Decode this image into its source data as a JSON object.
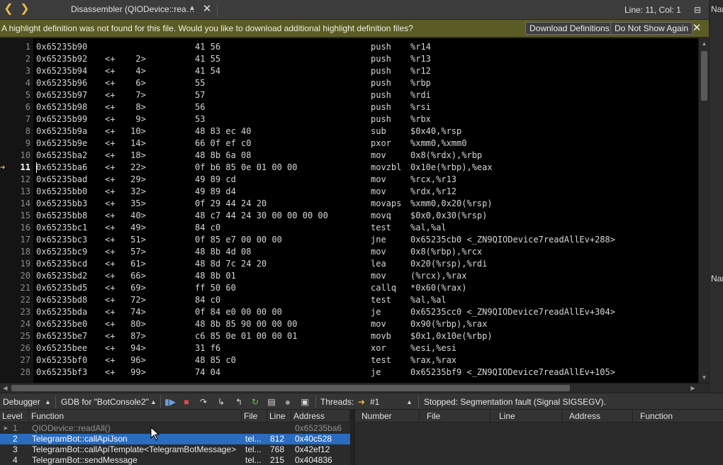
{
  "topbar": {
    "back_icon": "chevron-left-icon",
    "forward_icon": "chevron-right-icon",
    "document_title": "Disassembler (QIODevice::rea…",
    "chooser_icon": "updown-chevron-icon",
    "close_icon": "close-icon",
    "line_col": "Line: 11, Col: 1",
    "split_icon": "split-editor-icon",
    "accent_color": "#e8b84a"
  },
  "right_strip": {
    "label_top": "Nar",
    "label_bottom": "Nar"
  },
  "infobar": {
    "message": "A highlight definition was not found for this file. Would you like to download additional highlight definition files?",
    "download_button": "Download Definitions",
    "dont_show_button": "Do Not Show Again",
    "close_icon": "close-icon",
    "background_color": "#5b5b26"
  },
  "editor": {
    "current_line": 11,
    "lines": [
      {
        "n": "1",
        "addr": "0x65235b90",
        "rel": "",
        "bytes": "41 56",
        "mnem": "push",
        "ops": "%r14"
      },
      {
        "n": "2",
        "addr": "0x65235b92",
        "rel": "<+    2>",
        "bytes": "41 55",
        "mnem": "push",
        "ops": "%r13"
      },
      {
        "n": "3",
        "addr": "0x65235b94",
        "rel": "<+    4>",
        "bytes": "41 54",
        "mnem": "push",
        "ops": "%r12"
      },
      {
        "n": "4",
        "addr": "0x65235b96",
        "rel": "<+    6>",
        "bytes": "55",
        "mnem": "push",
        "ops": "%rbp"
      },
      {
        "n": "5",
        "addr": "0x65235b97",
        "rel": "<+    7>",
        "bytes": "57",
        "mnem": "push",
        "ops": "%rdi"
      },
      {
        "n": "6",
        "addr": "0x65235b98",
        "rel": "<+    8>",
        "bytes": "56",
        "mnem": "push",
        "ops": "%rsi"
      },
      {
        "n": "7",
        "addr": "0x65235b99",
        "rel": "<+    9>",
        "bytes": "53",
        "mnem": "push",
        "ops": "%rbx"
      },
      {
        "n": "8",
        "addr": "0x65235b9a",
        "rel": "<+   10>",
        "bytes": "48 83 ec 40",
        "mnem": "sub",
        "ops": "$0x40,%rsp"
      },
      {
        "n": "9",
        "addr": "0x65235b9e",
        "rel": "<+   14>",
        "bytes": "66 0f ef c0",
        "mnem": "pxor",
        "ops": "%xmm0,%xmm0"
      },
      {
        "n": "10",
        "addr": "0x65235ba2",
        "rel": "<+   18>",
        "bytes": "48 8b 6a 08",
        "mnem": "mov",
        "ops": "0x8(%rdx),%rbp"
      },
      {
        "n": "11",
        "addr": "0x65235ba6",
        "rel": "<+   22>",
        "bytes": "0f b6 85 0e 01 00 00",
        "mnem": "movzbl",
        "ops": "0x10e(%rbp),%eax"
      },
      {
        "n": "12",
        "addr": "0x65235bad",
        "rel": "<+   29>",
        "bytes": "49 89 cd",
        "mnem": "mov",
        "ops": "%rcx,%r13"
      },
      {
        "n": "13",
        "addr": "0x65235bb0",
        "rel": "<+   32>",
        "bytes": "49 89 d4",
        "mnem": "mov",
        "ops": "%rdx,%r12"
      },
      {
        "n": "14",
        "addr": "0x65235bb3",
        "rel": "<+   35>",
        "bytes": "0f 29 44 24 20",
        "mnem": "movaps",
        "ops": "%xmm0,0x20(%rsp)"
      },
      {
        "n": "15",
        "addr": "0x65235bb8",
        "rel": "<+   40>",
        "bytes": "48 c7 44 24 30 00 00 00 00",
        "mnem": "movq",
        "ops": "$0x0,0x30(%rsp)"
      },
      {
        "n": "16",
        "addr": "0x65235bc1",
        "rel": "<+   49>",
        "bytes": "84 c0",
        "mnem": "test",
        "ops": "%al,%al"
      },
      {
        "n": "17",
        "addr": "0x65235bc3",
        "rel": "<+   51>",
        "bytes": "0f 85 e7 00 00 00",
        "mnem": "jne",
        "ops": "0x65235cb0 <_ZN9QIODevice7readAllEv+288>"
      },
      {
        "n": "18",
        "addr": "0x65235bc9",
        "rel": "<+   57>",
        "bytes": "48 8b 4d 08",
        "mnem": "mov",
        "ops": "0x8(%rbp),%rcx"
      },
      {
        "n": "19",
        "addr": "0x65235bcd",
        "rel": "<+   61>",
        "bytes": "48 8d 7c 24 20",
        "mnem": "lea",
        "ops": "0x20(%rsp),%rdi"
      },
      {
        "n": "20",
        "addr": "0x65235bd2",
        "rel": "<+   66>",
        "bytes": "48 8b 01",
        "mnem": "mov",
        "ops": "(%rcx),%rax"
      },
      {
        "n": "21",
        "addr": "0x65235bd5",
        "rel": "<+   69>",
        "bytes": "ff 50 60",
        "mnem": "callq",
        "ops": "*0x60(%rax)"
      },
      {
        "n": "22",
        "addr": "0x65235bd8",
        "rel": "<+   72>",
        "bytes": "84 c0",
        "mnem": "test",
        "ops": "%al,%al"
      },
      {
        "n": "23",
        "addr": "0x65235bda",
        "rel": "<+   74>",
        "bytes": "0f 84 e0 00 00 00",
        "mnem": "je",
        "ops": "0x65235cc0 <_ZN9QIODevice7readAllEv+304>"
      },
      {
        "n": "24",
        "addr": "0x65235be0",
        "rel": "<+   80>",
        "bytes": "48 8b 85 90 00 00 00",
        "mnem": "mov",
        "ops": "0x90(%rbp),%rax"
      },
      {
        "n": "25",
        "addr": "0x65235be7",
        "rel": "<+   87>",
        "bytes": "c6 85 0e 01 00 00 01",
        "mnem": "movb",
        "ops": "$0x1,0x10e(%rbp)"
      },
      {
        "n": "26",
        "addr": "0x65235bee",
        "rel": "<+   94>",
        "bytes": "31 f6",
        "mnem": "xor",
        "ops": "%esi,%esi"
      },
      {
        "n": "27",
        "addr": "0x65235bf0",
        "rel": "<+   96>",
        "bytes": "48 85 c0",
        "mnem": "test",
        "ops": "%rax,%rax"
      },
      {
        "n": "28",
        "addr": "0x65235bf3",
        "rel": "<+   99>",
        "bytes": "74 04",
        "mnem": "je",
        "ops": "0x65235bf9 <_ZN9QIODevice7readAllEv+105>"
      }
    ]
  },
  "debugger_toolbar": {
    "mode": "Debugger",
    "engine": "GDB for \"BotConsole2\"",
    "icons": [
      "continue-icon",
      "stop-icon",
      "step-over-icon",
      "step-into-icon",
      "step-out-icon",
      "restart-icon",
      "operate-by-instruction-icon",
      "record-icon",
      "snapshot-icon"
    ],
    "threads_label": "Threads:",
    "thread_value": "#1",
    "thread_arrow_icon": "arrow-right-icon",
    "status": "Stopped: Segmentation fault (Signal SIGSEGV)."
  },
  "stack": {
    "headers": {
      "level": "Level",
      "function": "Function",
      "file": "File",
      "line": "Line",
      "address": "Address"
    },
    "rows": [
      {
        "level": "1",
        "function": "QIODevice::readAll()",
        "file": "",
        "line": "",
        "address": "0x65235ba6",
        "style": "dim"
      },
      {
        "level": "2",
        "function": "TelegramBot::callApiJson",
        "file": "tel...",
        "line": "812",
        "address": "0x40c528",
        "style": "selected"
      },
      {
        "level": "3",
        "function": "TelegramBot::callApiTemplate<TelegramBotMessage>",
        "file": "tel...",
        "line": "768",
        "address": "0x42ef12",
        "style": "normal"
      },
      {
        "level": "4",
        "function": "TelegramBot::sendMessage",
        "file": "tel...",
        "line": "215",
        "address": "0x404836",
        "style": "normal"
      }
    ],
    "selection_color": "#2a6cbf"
  },
  "breakpoints": {
    "headers": {
      "number": "Number",
      "file": "File",
      "line": "Line",
      "address": "Address",
      "function": "Function"
    }
  }
}
